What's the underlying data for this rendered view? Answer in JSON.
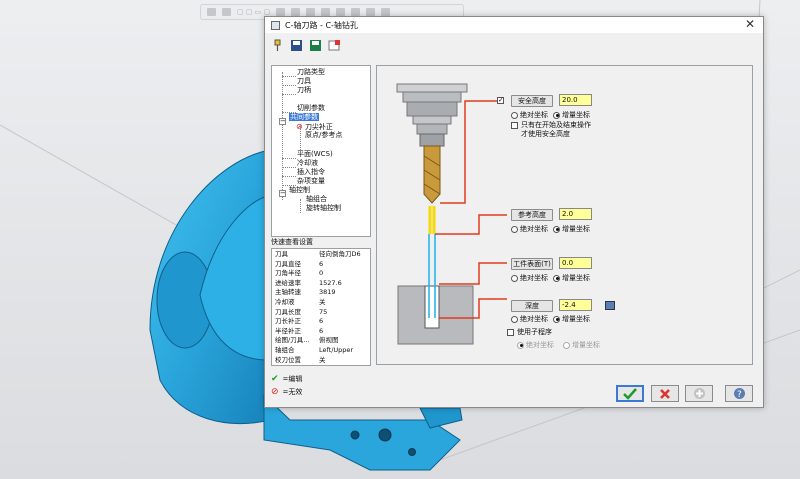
{
  "top_toolbar": {
    "text": "▢ ▢ ▭ ▢"
  },
  "dialog": {
    "title": "C-轴刀路 - C-轴钻孔",
    "close": "✕"
  },
  "tree": {
    "items": [
      "刀路类型",
      "刀具",
      "刀柄",
      "切削参数",
      "共同参数",
      "刀尖补正",
      "原点/参考点",
      "平面(WCS)",
      "冷却液",
      "插入指令",
      "杂项变量",
      "轴控制",
      "轴组合",
      "旋转轴控制"
    ]
  },
  "quick_view": {
    "title": "快速查看设置",
    "rows": [
      {
        "k": "刀具",
        "v": "径向倒角刀D6"
      },
      {
        "k": "刀具直径",
        "v": "6"
      },
      {
        "k": "刀角半径",
        "v": "0"
      },
      {
        "k": "进给速率",
        "v": "1527.6"
      },
      {
        "k": "主轴转速",
        "v": "3819"
      },
      {
        "k": "冷却液",
        "v": "关"
      },
      {
        "k": "刀具长度",
        "v": "75"
      },
      {
        "k": "刀长补正",
        "v": "6"
      },
      {
        "k": "半径补正",
        "v": "6"
      },
      {
        "k": "绘图/刀具...",
        "v": "俯视图"
      },
      {
        "k": "轴组合",
        "v": "Left/Upper"
      },
      {
        "k": "校刀位置",
        "v": "关"
      }
    ]
  },
  "legend": {
    "edit": "=编辑",
    "invalid": "=无效"
  },
  "params": {
    "clearance": {
      "label": "安全高度",
      "value": "20.0"
    },
    "retract": {
      "label": "参考高度",
      "value": "2.0"
    },
    "top": {
      "label": "工件表面(T)",
      "value": "0.0"
    },
    "depth": {
      "label": "深度",
      "value": "-2.4"
    },
    "absolute": "绝对坐标",
    "incremental": "增量坐标",
    "start_end_only_1": "只有在开始及结束操作",
    "start_end_only_2": "才使用安全高度",
    "subprogram": "使用子程序"
  },
  "colors": {
    "accent": "#3b79d6",
    "clearance_line": "#e03a1e",
    "yellow": "#f5d90a",
    "cyan": "#29b6e8",
    "cad_blue": "#29aee4"
  }
}
